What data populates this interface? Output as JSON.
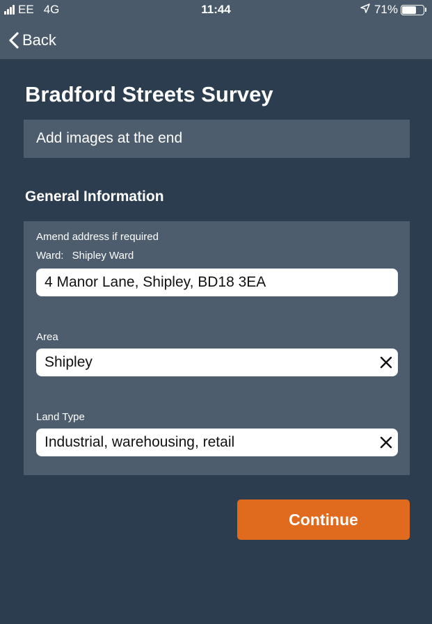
{
  "status_bar": {
    "carrier": "EE",
    "network": "4G",
    "time": "11:44",
    "location_icon": "location-arrow-icon",
    "battery_label": "71%",
    "battery_level": 0.71
  },
  "nav": {
    "back_label": "Back",
    "back_icon": "chevron-left-icon"
  },
  "page": {
    "title": "Bradford Streets Survey",
    "banner": "Add images at the end",
    "section_title": "General Information"
  },
  "form": {
    "address_hint": "Amend address if required",
    "ward_label": "Ward:",
    "ward_value": "Shipley Ward",
    "address_value": "4 Manor Lane, Shipley, BD18 3EA",
    "area_label": "Area",
    "area_value": "Shipley",
    "land_type_label": "Land Type",
    "land_type_value": "Industrial, warehousing, retail",
    "clear_icon": "close-icon"
  },
  "actions": {
    "continue_label": "Continue"
  },
  "colors": {
    "background": "#2c3d50",
    "bar": "#4a5a6b",
    "panel": "#4d5d6e",
    "accent": "#e06a1e"
  }
}
